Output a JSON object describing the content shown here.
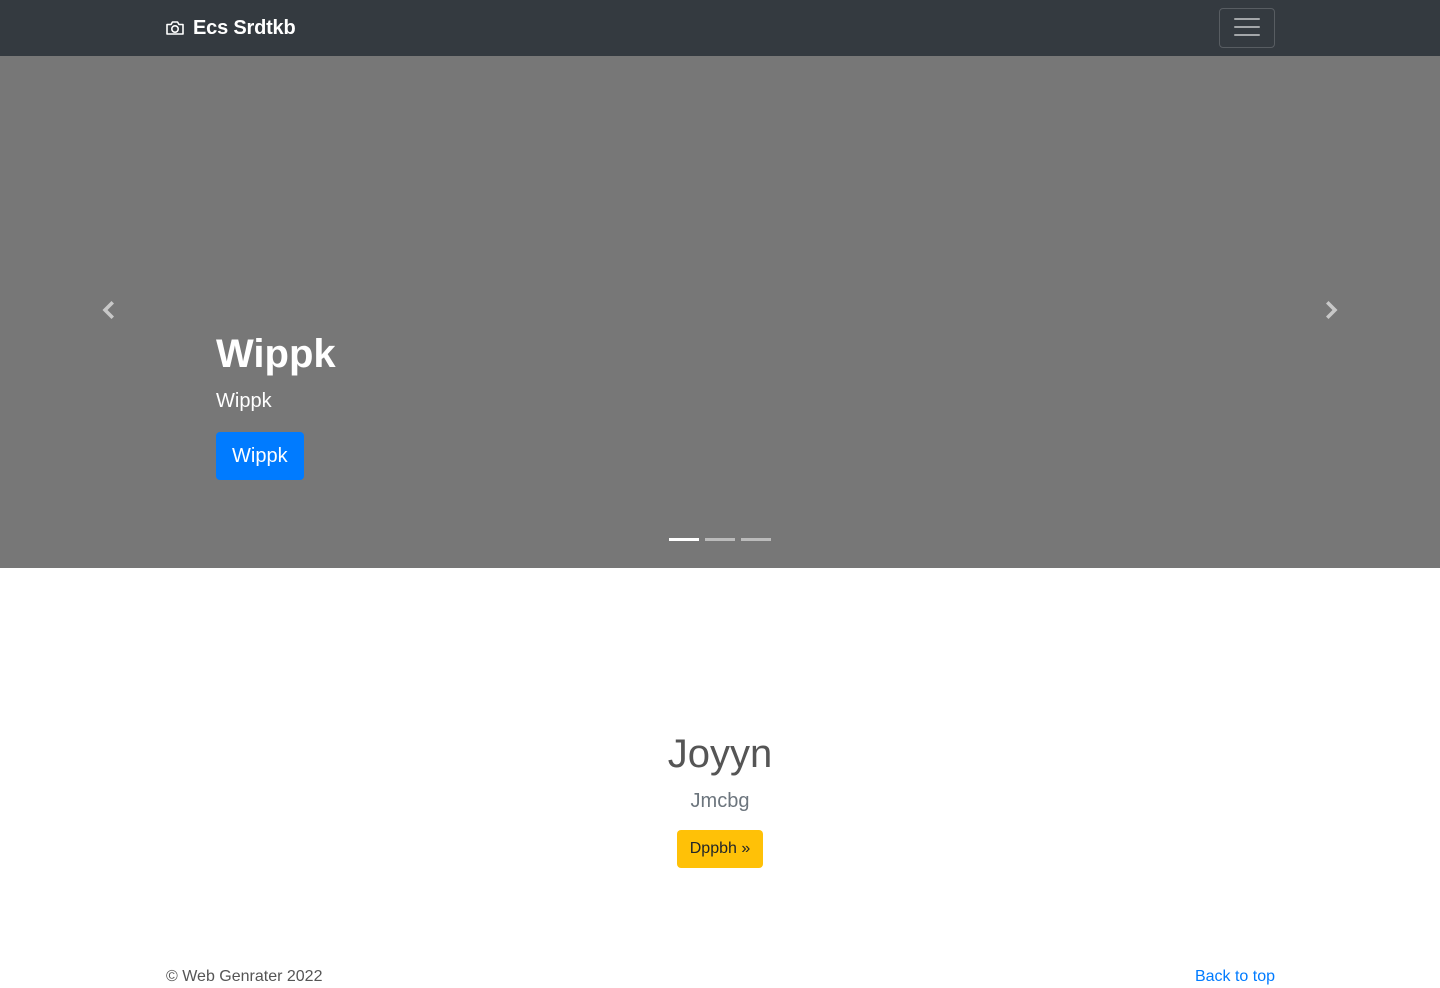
{
  "navbar": {
    "brand_label": "Ecs Srdtkb",
    "brand_icon": "camera-icon",
    "toggler_icon": "hamburger-menu-icon",
    "background": "#343a40"
  },
  "carousel": {
    "background": "#777777",
    "slide": {
      "heading": "Wippk",
      "text": "Wippk",
      "button_label": "Wippk"
    },
    "prev_icon": "chevron-left-icon",
    "next_icon": "chevron-right-icon",
    "indicator_count": 3,
    "active_indicator": 1
  },
  "main": {
    "heading": "Joyyn",
    "lead": "Jmcbg",
    "button_label": "Dppbh »"
  },
  "footer": {
    "copyright": "© Web Genrater 2022",
    "back_to_top": "Back to top"
  },
  "colors": {
    "primary": "#007bff",
    "warning": "#ffc107"
  }
}
